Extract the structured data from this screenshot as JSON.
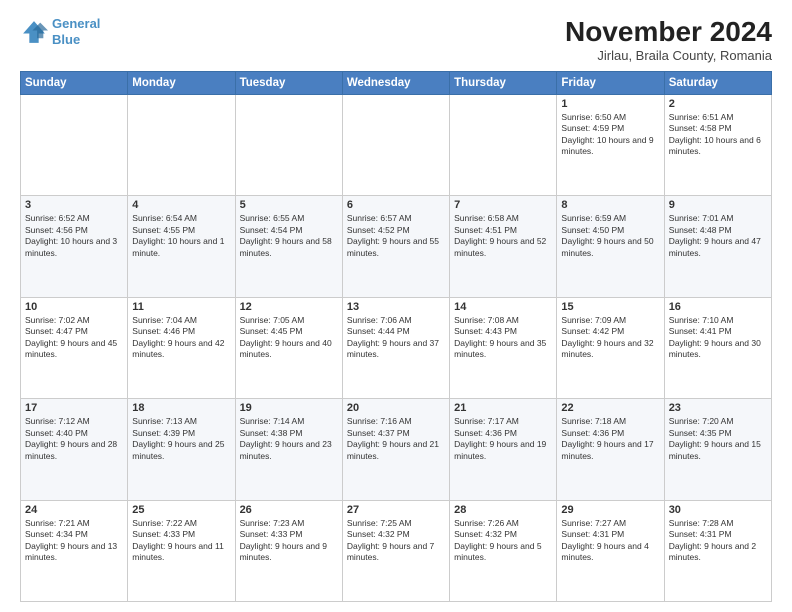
{
  "header": {
    "logo_line1": "General",
    "logo_line2": "Blue",
    "title": "November 2024",
    "subtitle": "Jirlau, Braila County, Romania"
  },
  "columns": [
    "Sunday",
    "Monday",
    "Tuesday",
    "Wednesday",
    "Thursday",
    "Friday",
    "Saturday"
  ],
  "weeks": [
    {
      "days": [
        {
          "num": "",
          "info": ""
        },
        {
          "num": "",
          "info": ""
        },
        {
          "num": "",
          "info": ""
        },
        {
          "num": "",
          "info": ""
        },
        {
          "num": "",
          "info": ""
        },
        {
          "num": "1",
          "info": "Sunrise: 6:50 AM\nSunset: 4:59 PM\nDaylight: 10 hours and 9 minutes."
        },
        {
          "num": "2",
          "info": "Sunrise: 6:51 AM\nSunset: 4:58 PM\nDaylight: 10 hours and 6 minutes."
        }
      ]
    },
    {
      "days": [
        {
          "num": "3",
          "info": "Sunrise: 6:52 AM\nSunset: 4:56 PM\nDaylight: 10 hours and 3 minutes."
        },
        {
          "num": "4",
          "info": "Sunrise: 6:54 AM\nSunset: 4:55 PM\nDaylight: 10 hours and 1 minute."
        },
        {
          "num": "5",
          "info": "Sunrise: 6:55 AM\nSunset: 4:54 PM\nDaylight: 9 hours and 58 minutes."
        },
        {
          "num": "6",
          "info": "Sunrise: 6:57 AM\nSunset: 4:52 PM\nDaylight: 9 hours and 55 minutes."
        },
        {
          "num": "7",
          "info": "Sunrise: 6:58 AM\nSunset: 4:51 PM\nDaylight: 9 hours and 52 minutes."
        },
        {
          "num": "8",
          "info": "Sunrise: 6:59 AM\nSunset: 4:50 PM\nDaylight: 9 hours and 50 minutes."
        },
        {
          "num": "9",
          "info": "Sunrise: 7:01 AM\nSunset: 4:48 PM\nDaylight: 9 hours and 47 minutes."
        }
      ]
    },
    {
      "days": [
        {
          "num": "10",
          "info": "Sunrise: 7:02 AM\nSunset: 4:47 PM\nDaylight: 9 hours and 45 minutes."
        },
        {
          "num": "11",
          "info": "Sunrise: 7:04 AM\nSunset: 4:46 PM\nDaylight: 9 hours and 42 minutes."
        },
        {
          "num": "12",
          "info": "Sunrise: 7:05 AM\nSunset: 4:45 PM\nDaylight: 9 hours and 40 minutes."
        },
        {
          "num": "13",
          "info": "Sunrise: 7:06 AM\nSunset: 4:44 PM\nDaylight: 9 hours and 37 minutes."
        },
        {
          "num": "14",
          "info": "Sunrise: 7:08 AM\nSunset: 4:43 PM\nDaylight: 9 hours and 35 minutes."
        },
        {
          "num": "15",
          "info": "Sunrise: 7:09 AM\nSunset: 4:42 PM\nDaylight: 9 hours and 32 minutes."
        },
        {
          "num": "16",
          "info": "Sunrise: 7:10 AM\nSunset: 4:41 PM\nDaylight: 9 hours and 30 minutes."
        }
      ]
    },
    {
      "days": [
        {
          "num": "17",
          "info": "Sunrise: 7:12 AM\nSunset: 4:40 PM\nDaylight: 9 hours and 28 minutes."
        },
        {
          "num": "18",
          "info": "Sunrise: 7:13 AM\nSunset: 4:39 PM\nDaylight: 9 hours and 25 minutes."
        },
        {
          "num": "19",
          "info": "Sunrise: 7:14 AM\nSunset: 4:38 PM\nDaylight: 9 hours and 23 minutes."
        },
        {
          "num": "20",
          "info": "Sunrise: 7:16 AM\nSunset: 4:37 PM\nDaylight: 9 hours and 21 minutes."
        },
        {
          "num": "21",
          "info": "Sunrise: 7:17 AM\nSunset: 4:36 PM\nDaylight: 9 hours and 19 minutes."
        },
        {
          "num": "22",
          "info": "Sunrise: 7:18 AM\nSunset: 4:36 PM\nDaylight: 9 hours and 17 minutes."
        },
        {
          "num": "23",
          "info": "Sunrise: 7:20 AM\nSunset: 4:35 PM\nDaylight: 9 hours and 15 minutes."
        }
      ]
    },
    {
      "days": [
        {
          "num": "24",
          "info": "Sunrise: 7:21 AM\nSunset: 4:34 PM\nDaylight: 9 hours and 13 minutes."
        },
        {
          "num": "25",
          "info": "Sunrise: 7:22 AM\nSunset: 4:33 PM\nDaylight: 9 hours and 11 minutes."
        },
        {
          "num": "26",
          "info": "Sunrise: 7:23 AM\nSunset: 4:33 PM\nDaylight: 9 hours and 9 minutes."
        },
        {
          "num": "27",
          "info": "Sunrise: 7:25 AM\nSunset: 4:32 PM\nDaylight: 9 hours and 7 minutes."
        },
        {
          "num": "28",
          "info": "Sunrise: 7:26 AM\nSunset: 4:32 PM\nDaylight: 9 hours and 5 minutes."
        },
        {
          "num": "29",
          "info": "Sunrise: 7:27 AM\nSunset: 4:31 PM\nDaylight: 9 hours and 4 minutes."
        },
        {
          "num": "30",
          "info": "Sunrise: 7:28 AM\nSunset: 4:31 PM\nDaylight: 9 hours and 2 minutes."
        }
      ]
    }
  ]
}
